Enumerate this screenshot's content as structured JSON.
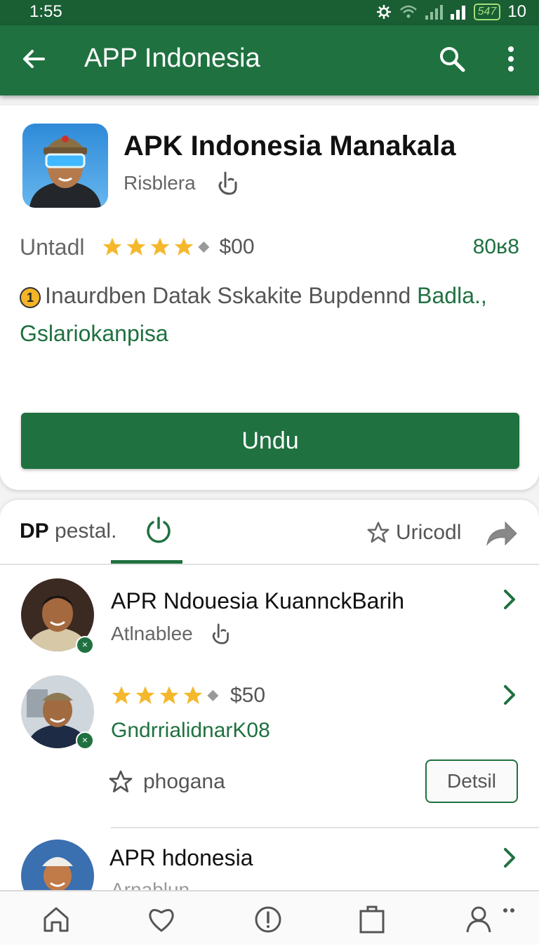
{
  "status_bar": {
    "time": "1:55",
    "battery": "547",
    "battery_level": "10"
  },
  "app_bar": {
    "title": "APP Indonesia"
  },
  "app": {
    "name": "APK Indonesia Manakala",
    "developer": "Risblera",
    "installed_label": "Untadl",
    "rating_stars": 4,
    "price": "$00",
    "count": "80ʁ8",
    "description_prefix": "Inaurdben Datak Sskakite Bupdennd",
    "description_green_1": "Badla.,",
    "description_green_2": "Gslariokanpisa",
    "coin_symbol": "1",
    "download_label": "Undu"
  },
  "tabs": {
    "dp_bold": "DP",
    "dp_rest": "pestal.",
    "uricodl": "Uricodl"
  },
  "list": [
    {
      "title": "APR Ndouesia KuannckBarih",
      "subtitle": "Atlnablee"
    },
    {
      "rating_stars": 4,
      "price": "$50",
      "green": "GndrrialidnarK08",
      "favorite_label": "phogana",
      "detail_label": "Detsil"
    },
    {
      "title": "APR hdonesia",
      "subtitle": "Arnablun"
    }
  ],
  "colors": {
    "primary": "#1f7140",
    "status_bar": "#1a5e34",
    "star": "#f5b82c"
  },
  "icons": [
    "back-arrow-icon",
    "search-icon",
    "more-vert-icon",
    "touch-icon",
    "star-icon",
    "power-icon",
    "share-icon",
    "chevron-right-icon",
    "home-icon",
    "heart-icon",
    "info-icon",
    "clipboard-icon",
    "person-icon"
  ]
}
